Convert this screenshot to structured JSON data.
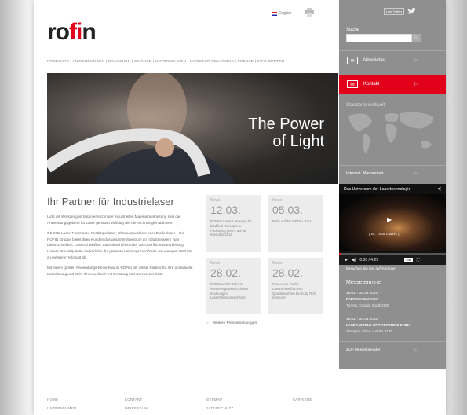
{
  "header": {
    "logo_prefix": "ro",
    "logo_accent": "fi",
    "logo_suffix": "n",
    "language": "English",
    "nav": "PRODUKTE  |  ANWENDUNGEN  |  BRANCHEN  |  SERVICE  |  UNTERNEHMEN  |  INVESTOR RELATIONS  |  PRESSE  |  INFO CENTER"
  },
  "hero": {
    "line1": "The Power",
    "line2": "of Light"
  },
  "main": {
    "title": "Ihr Partner für Industrielaser",
    "paragraphs": [
      "Licht als Werkzeug ist faszinierend: in der industriellen Materialbearbeitung sind die Anwendungsgebiete für Laser genauso vielfältig wie die Technologien dahinter.",
      "Ob CO2 Laser, Faserlaser, Festkörperlaser, Ultrakurzpulslaser oder Diodenlaser – Die ROFIN Gruppe bietet ihren Kunden das gesamte Spektrum an Industrielasern zum Laserschneiden, Laserschweißen, Laserbeschriften oder zur Oberflächenbearbeitung. Unsere Produktpalette deckt dabei die gesamte Leistungsbandbreite von wenigen Watt bis zu mehreren Kilowatt ab.",
      "Mit einem großen Anwendungs-Know-how ist ROFIN der ideale Partner für Ihre individuelle Laserlösung und steht Ihnen weltweit mit Beratung und Service zur Seite."
    ],
    "news": [
      {
        "label": "News",
        "date": "12.03.",
        "text": "ROFINs Laser-Lösungen für Modified Atmosphere Packaging (MAP) auf der Interpack 2014"
      },
      {
        "label": "News",
        "date": "05.03.",
        "text": "Rofin auf der METAV 2014"
      },
      {
        "label": "News",
        "date": "28.02.",
        "text": "ROFIN erzielt Rekord-Vorsteuergewinn inklusive eindeutigem Laserfahrzeugwachstum"
      },
      {
        "label": "News",
        "date": "28.02.",
        "text": "Eine runde Sache: Laserschweißen von Qualitätsrohren bei Eddy Rohr in Siegen"
      }
    ],
    "more_news": "Weitere Pressemeldungen"
  },
  "footer": {
    "links": [
      "HOME",
      "UNTERNEHMEN",
      "KONTAKT",
      "IMPRESSUM",
      "SITEMAP",
      "DATENSCHUTZ",
      "KARRIERE"
    ]
  },
  "sidebar": {
    "social_label": "Like  Twitter",
    "search_label": "Suche",
    "search_placeholder": "",
    "newsletter": "Newsletter",
    "contact": "Kontakt",
    "locations": "Standorte weltweit:",
    "international": "Internat. Webseiten",
    "video_title": "Das Universum der Lasertechnologie",
    "video_caption": "[ ca. 1000 Lasers ]",
    "video_time": "0:00 / 4:29",
    "youtube_link": "Besuchen Sie uns auf YouTube",
    "events_title": "Messetermine",
    "events": [
      {
        "date": "18.03. - 20.03.2014",
        "title": "FABTECH CANADA",
        "location": "Toronto, Canada, Booth 2005"
      },
      {
        "date": "18.03. - 20.03.2014",
        "title": "LASER WORLD OF PHOTONICS CHINA",
        "location": "Shanghai, China, Hall E3, 3180"
      }
    ],
    "events_all": "Zum Messekalender",
    "colors": {
      "accent": "#e2001a",
      "sidebar": "#8f8f8f"
    }
  }
}
